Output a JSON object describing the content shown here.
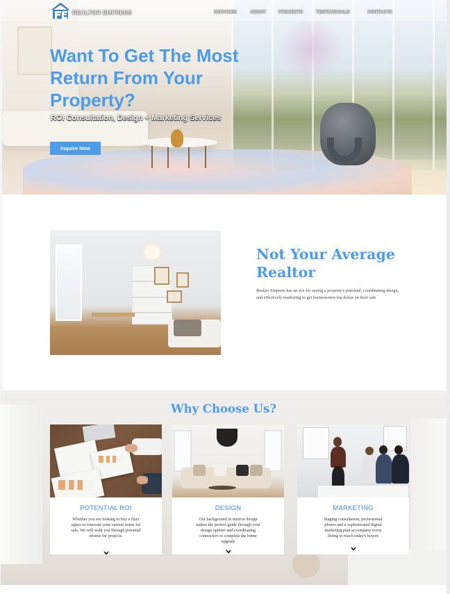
{
  "brand": {
    "name": "REALTOR EMPRESS",
    "accent": "#4e9be8"
  },
  "nav": {
    "items": [
      "SERVICES",
      "ABOUT",
      "PROJECTS",
      "TESTIMONIALS",
      "CONTACTS"
    ]
  },
  "hero": {
    "title": "Want To Get The Most Return From Your Property?",
    "subtitle": "ROI Consultation, Design + Marketing Services",
    "cta_label": "Inquire Now"
  },
  "about": {
    "title": "Not Your Average Realtor",
    "text": "Realtor Empress has an eye for seeing a property's  potential, coordinating design, and effectively marketing to get homeowners top dollar on their sale"
  },
  "why": {
    "title": "Why Choose Us?",
    "cards": [
      {
        "title": "POTENTIAL ROI",
        "text": "Whether you are looking to buy a fixer upper or renovate your current home for sale, We will walk you through potential returns for projects.",
        "icon": "chevron-down-icon"
      },
      {
        "title": "DESIGN",
        "text": "Our background in interior design makes the perfect guide through your design options and coordinating contractors to complete the home upgrade",
        "icon": "chevron-down-icon"
      },
      {
        "title": "MARKETING",
        "text": "Staging consultation, professional photos and a sophisticated digital marketing plan accompany every listing to reach today's buyers",
        "icon": "chevron-down-icon"
      }
    ]
  }
}
